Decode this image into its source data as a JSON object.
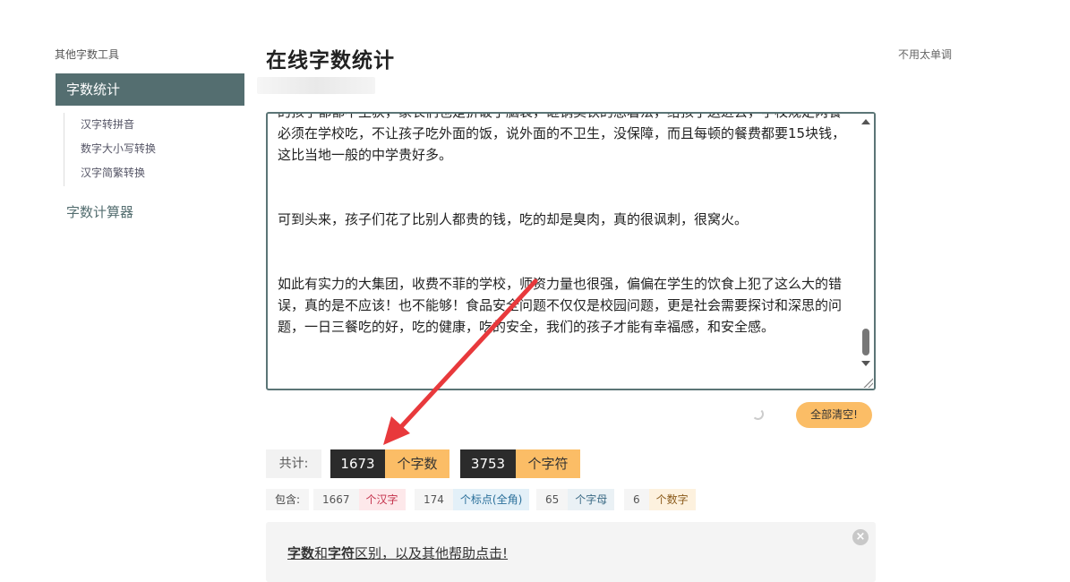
{
  "sidebar": {
    "heading": "其他字数工具",
    "active_item": "字数统计",
    "sub_items": [
      "汉字转拼音",
      "数字大小写转换",
      "汉字简繁转换"
    ],
    "calculator": "字数计算器"
  },
  "header": {
    "title": "在线字数统计",
    "right_note": "不用太单调"
  },
  "editor": {
    "paragraphs": [
      "的孩子都都不生获，家长们也是折破了脑袋，砸锅卖铁的想着法，给孩子送进去，学校规定两餐必须在学校吃，不让孩子吃外面的饭，说外面的不卫生，没保障，而且每顿的餐费都要15块钱，这比当地一般的中学贵好多。",
      "可到头来，孩子们花了比别人都贵的钱，吃的却是臭肉，真的很讽刺，很窝火。",
      "如此有实力的大集团，收费不菲的学校，师资力量也很强，偏偏在学生的饮食上犯了这么大的错误，真的是不应该！也不能够！食品安全问题不仅仅是校园问题，更是社会需要探讨和深思的问题，一日三餐吃的好，吃的健康，吃的安全，我们的孩子才能有幸福感，和安全感。"
    ]
  },
  "actions": {
    "clear_label": "全部清空!"
  },
  "stats": {
    "total_label": "共计:",
    "word_count": "1673",
    "word_unit": "个字数",
    "char_count": "3753",
    "char_unit": "个字符",
    "contains_label": "包含:",
    "hanzi_count": "1667",
    "hanzi_label": "个汉字",
    "punct_count": "174",
    "punct_label": "个标点(全角)",
    "letter_count": "65",
    "letter_label": "个字母",
    "digit_count": "6",
    "digit_label": "个数字"
  },
  "help": {
    "part1": "字数",
    "part2": "和",
    "part3": "字符",
    "part4": "区别，以及其他帮助点击!"
  },
  "colors": {
    "accent": "#546e70",
    "orange": "#fbbd66",
    "dark": "#2b2b2b",
    "arrow": "#e8393c"
  }
}
